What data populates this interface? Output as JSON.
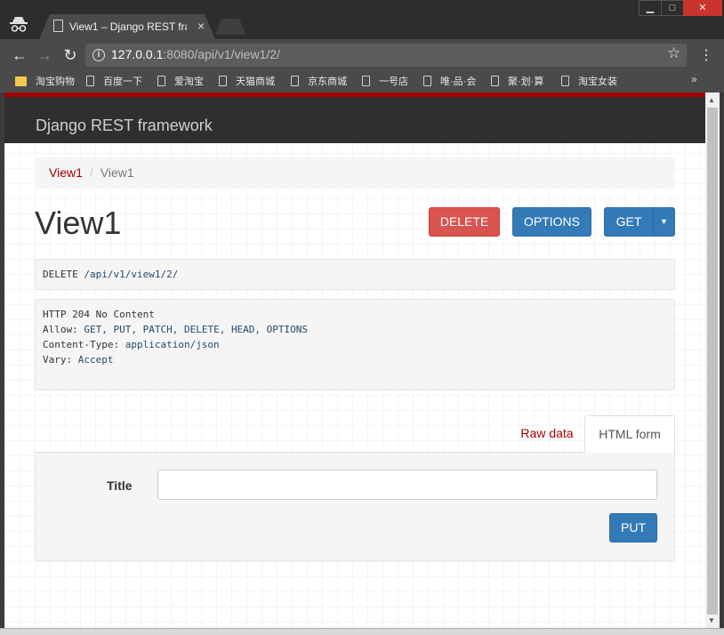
{
  "browser": {
    "tab_title": "View1 – Django REST framework",
    "url_host": "127.0.0.1",
    "url_rest": ":8080/api/v1/view1/2/",
    "bookmarks": [
      {
        "label": "淘宝购物",
        "icon": "folder-icon"
      },
      {
        "label": "百度一下",
        "icon": "page-icon"
      },
      {
        "label": "爱淘宝",
        "icon": "page-icon"
      },
      {
        "label": "天猫商城",
        "icon": "page-icon"
      },
      {
        "label": "京东商城",
        "icon": "page-icon"
      },
      {
        "label": "一号店",
        "icon": "page-icon"
      },
      {
        "label": "唯·品·会",
        "icon": "page-icon"
      },
      {
        "label": "聚·划·算",
        "icon": "page-icon"
      },
      {
        "label": "淘宝女装",
        "icon": "page-icon"
      }
    ],
    "more": "»"
  },
  "navbar": {
    "brand": "Django REST framework"
  },
  "breadcrumb": {
    "link": "View1",
    "separator": "/",
    "current": "View1"
  },
  "page": {
    "title": "View1",
    "buttons": {
      "delete": "DELETE",
      "options": "OPTIONS",
      "get": "GET"
    }
  },
  "request": {
    "method": "DELETE",
    "path": "/api/v1/view1/2/"
  },
  "response": {
    "status": "HTTP 204 No Content",
    "allow_key": "Allow:",
    "allow_value": "GET, PUT, PATCH, DELETE, HEAD, OPTIONS",
    "content_type_key": "Content-Type:",
    "content_type_value": "application/json",
    "vary_key": "Vary:",
    "vary_value": "Accept"
  },
  "form": {
    "tabs": {
      "raw": "Raw data",
      "html": "HTML form"
    },
    "field_label": "Title",
    "field_value": "",
    "submit": "PUT"
  },
  "colors": {
    "brand_red": "#a30000",
    "primary": "#337ab7",
    "danger": "#d9534f"
  }
}
